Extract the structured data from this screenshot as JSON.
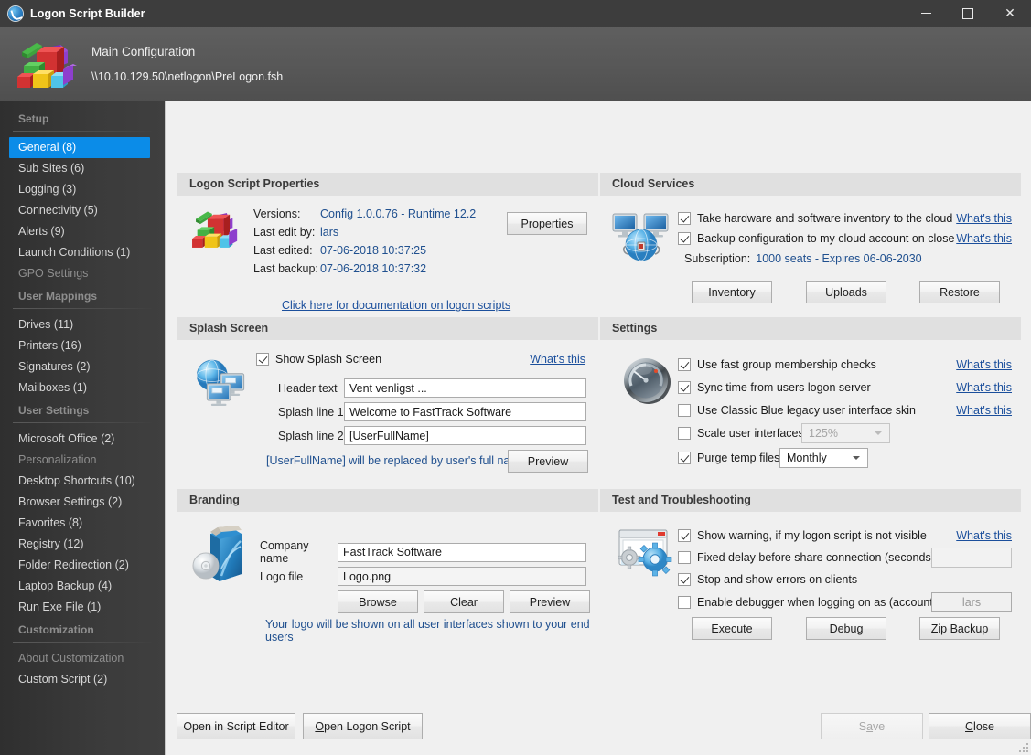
{
  "window": {
    "title": "Logon Script Builder",
    "app_icon": "app-logo-icon",
    "minimize": "–",
    "maximize": "□",
    "close": "✕"
  },
  "header": {
    "icon": "building-blocks-icon",
    "title": "Main Configuration",
    "path": "\\\\10.10.129.50\\netlogon\\PreLogon.fsh"
  },
  "sidebar": {
    "groups": [
      {
        "title": "Setup",
        "items": [
          {
            "label": "General (8)",
            "selected": true,
            "dim": false
          },
          {
            "label": "Sub Sites (6)",
            "selected": false,
            "dim": false
          },
          {
            "label": "Logging (3)",
            "selected": false,
            "dim": false
          },
          {
            "label": "Connectivity (5)",
            "selected": false,
            "dim": false
          },
          {
            "label": "Alerts (9)",
            "selected": false,
            "dim": false
          },
          {
            "label": "Launch Conditions (1)",
            "selected": false,
            "dim": false
          },
          {
            "label": "GPO Settings",
            "selected": false,
            "dim": true
          }
        ]
      },
      {
        "title": "User Mappings",
        "items": [
          {
            "label": "Drives (11)",
            "selected": false,
            "dim": false
          },
          {
            "label": "Printers (16)",
            "selected": false,
            "dim": false
          },
          {
            "label": "Signatures (2)",
            "selected": false,
            "dim": false
          },
          {
            "label": "Mailboxes (1)",
            "selected": false,
            "dim": false
          }
        ]
      },
      {
        "title": "User Settings",
        "items": [
          {
            "label": "Microsoft Office (2)",
            "selected": false,
            "dim": false
          },
          {
            "label": "Personalization",
            "selected": false,
            "dim": true
          },
          {
            "label": "Desktop Shortcuts (10)",
            "selected": false,
            "dim": false
          },
          {
            "label": "Browser Settings (2)",
            "selected": false,
            "dim": false
          },
          {
            "label": "Favorites (8)",
            "selected": false,
            "dim": false
          },
          {
            "label": "Registry (12)",
            "selected": false,
            "dim": false
          },
          {
            "label": "Folder Redirection (2)",
            "selected": false,
            "dim": false
          },
          {
            "label": "Laptop Backup (4)",
            "selected": false,
            "dim": false
          },
          {
            "label": "Run Exe File (1)",
            "selected": false,
            "dim": false
          }
        ]
      },
      {
        "title": "Customization",
        "items": [
          {
            "label": "About Customization",
            "selected": false,
            "dim": true
          },
          {
            "label": "Custom Script (2)",
            "selected": false,
            "dim": false
          }
        ]
      }
    ]
  },
  "logon_script_properties": {
    "title": "Logon Script Properties",
    "icon": "building-blocks-icon",
    "labels": {
      "versions": "Versions:",
      "last_edit_by": "Last edit by:",
      "last_edited": "Last edited:",
      "last_backup": "Last backup:"
    },
    "values": {
      "versions": "Config 1.0.0.76 - Runtime 12.2",
      "last_edit_by": "lars",
      "last_edited": "07-06-2018 10:37:25",
      "last_backup": "07-06-2018 10:37:32"
    },
    "doc_link": "Click here for documentation on logon scripts",
    "properties_button": "Properties"
  },
  "cloud_services": {
    "title": "Cloud Services",
    "icon": "network-cloud-icon",
    "checkboxes": [
      {
        "label": "Take hardware and software inventory to the cloud",
        "checked": true,
        "help": "What's this"
      },
      {
        "label": "Backup configuration to my cloud account on close",
        "checked": true,
        "help": "What's this"
      }
    ],
    "subscription_label": "Subscription:",
    "subscription_value": "1000 seats  -  Expires 06-06-2030",
    "buttons": [
      "Inventory",
      "Uploads",
      "Restore"
    ]
  },
  "splash_screen": {
    "title": "Splash Screen",
    "icon": "globe-monitors-icon",
    "show_checkbox": {
      "label": "Show Splash Screen",
      "checked": true
    },
    "help": "What's this",
    "fields": [
      {
        "label": "Header text",
        "value": "Vent venligst ..."
      },
      {
        "label": "Splash line 1",
        "value": "Welcome to FastTrack Software"
      },
      {
        "label": "Splash line 2",
        "value": "[UserFullName]"
      }
    ],
    "note": "[UserFullName] will be replaced by user's full name",
    "preview_button": "Preview"
  },
  "settings": {
    "title": "Settings",
    "icon": "gauge-icon",
    "rows": [
      {
        "label": "Use fast group membership checks",
        "checked": true,
        "help": "What's this"
      },
      {
        "label": "Sync time from users logon server",
        "checked": true,
        "help": "What's this"
      },
      {
        "label": "Use Classic Blue legacy user interface skin",
        "checked": false,
        "help": "What's this"
      },
      {
        "label": "Scale user interfaces to",
        "checked": false,
        "help": ""
      },
      {
        "label": "Purge temp files",
        "checked": true,
        "help": ""
      }
    ],
    "scale_value": "125%",
    "scale_disabled": true,
    "purge_value": "Monthly"
  },
  "branding": {
    "title": "Branding",
    "icon": "software-box-cd-icon",
    "company_label": "Company name",
    "company_value": "FastTrack Software",
    "logo_label": "Logo file",
    "logo_value": "Logo.png",
    "buttons": [
      "Browse",
      "Clear",
      "Preview"
    ],
    "note": "Your logo will be shown on all user interfaces shown to your end users"
  },
  "test_and_troubleshooting": {
    "title": "Test and Troubleshooting",
    "icon": "window-gears-icon",
    "rows": [
      {
        "label": "Show warning, if my logon script is not visible",
        "checked": true,
        "help": "What's this"
      },
      {
        "label": "Fixed delay before share connection (seconds):",
        "checked": false,
        "help": ""
      },
      {
        "label": "Stop and show errors on clients",
        "checked": true,
        "help": ""
      },
      {
        "label": "Enable debugger when logging on as (account):",
        "checked": false,
        "help": ""
      }
    ],
    "delay_value": "",
    "account_value": "lars",
    "buttons": [
      "Execute",
      "Debug",
      "Zip Backup"
    ]
  },
  "footer": {
    "open_script_editor": "Open in Script Editor",
    "open_logon_script": "Open Logon Script",
    "open_logon_script_accel": "O",
    "save": "Save",
    "save_accel": "a",
    "save_disabled": true,
    "close": "Close",
    "close_accel": "C"
  }
}
